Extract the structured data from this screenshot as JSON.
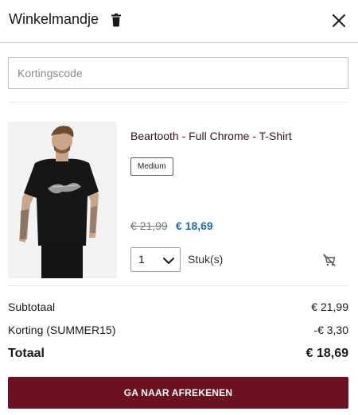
{
  "header": {
    "title": "Winkelmandje",
    "trash_icon": "trash-icon",
    "close_icon": "close-icon"
  },
  "coupon": {
    "placeholder": "Kortingscode",
    "value": ""
  },
  "item": {
    "image_icon": "product-photo-tshirt",
    "name": "Beartooth - Full Chrome - T-Shirt",
    "variant": "Medium",
    "price_old": "€ 21,99",
    "price_new": "€ 18,69",
    "quantity": "1",
    "unit": "Stuk(s)",
    "remove_icon": "remove-from-cart-icon"
  },
  "summary": {
    "subtotal_label": "Subtotaal",
    "subtotal_value": "€ 21,99",
    "discount_label": "Korting (SUMMER15)",
    "discount_value": "-€ 3,30",
    "total_label": "Totaal",
    "total_value": "€ 18,69"
  },
  "checkout": {
    "label": "GA NAAR AFREKENEN"
  },
  "colors": {
    "accent": "#6b1120",
    "price_new": "#1f6aa5",
    "product_name": "#3a1418"
  }
}
